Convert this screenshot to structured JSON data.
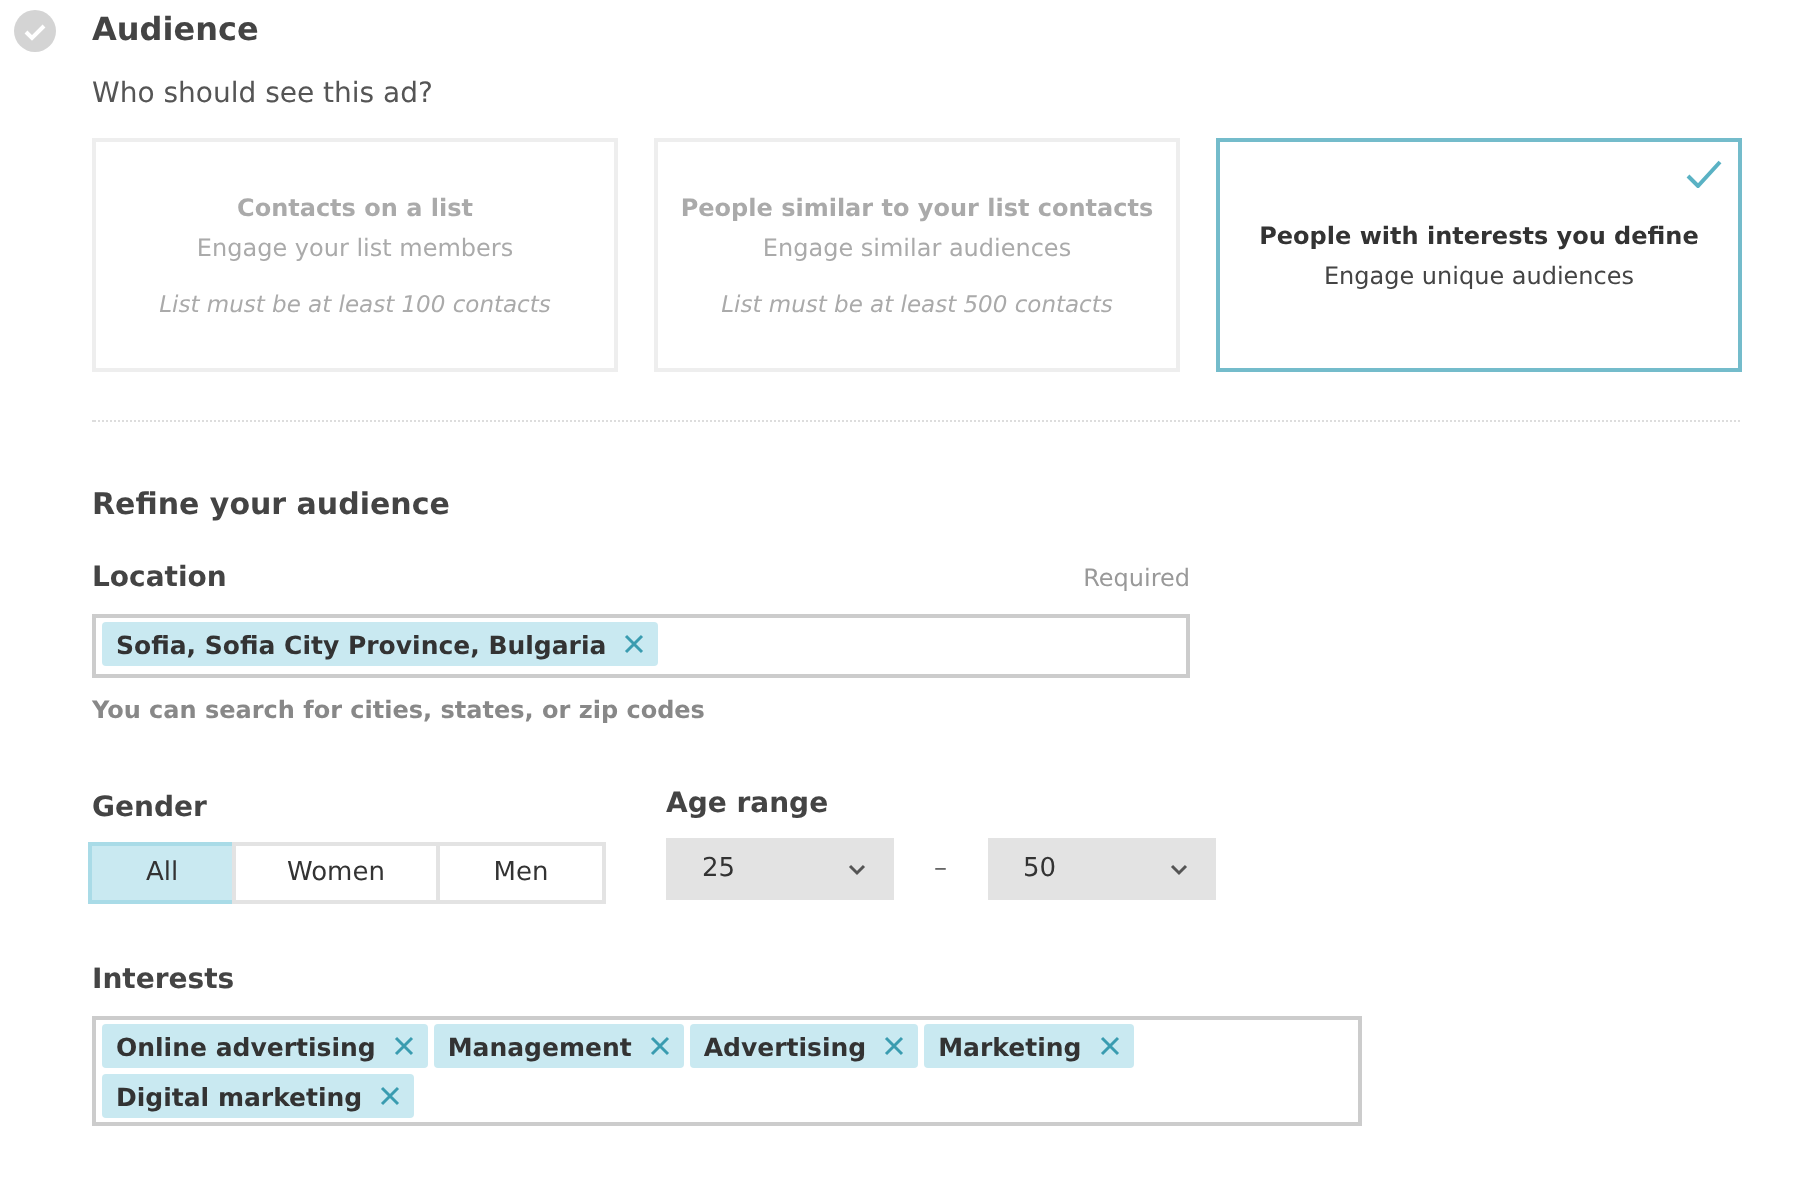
{
  "section": {
    "title": "Audience",
    "completed": true
  },
  "question": "Who should see this ad?",
  "audience_options": [
    {
      "title": "Contacts on a list",
      "subtitle": "Engage your list members",
      "note": "List must be at least 100 contacts",
      "selected": false
    },
    {
      "title": "People similar to your list contacts",
      "subtitle": "Engage similar audiences",
      "note": "List must be at least 500 contacts",
      "selected": false
    },
    {
      "title": "People with interests you define",
      "subtitle": "Engage unique audiences",
      "selected": true
    }
  ],
  "refine_title": "Refine your audience",
  "location": {
    "label": "Location",
    "required_label": "Required",
    "tags": [
      "Sofia, Sofia City Province, Bulgaria"
    ],
    "hint": "You can search for cities, states, or zip codes"
  },
  "gender": {
    "label": "Gender",
    "options": [
      {
        "label": "All",
        "selected": true
      },
      {
        "label": "Women",
        "selected": false
      },
      {
        "label": "Men",
        "selected": false
      }
    ]
  },
  "age_range": {
    "label": "Age range",
    "min": "25",
    "separator": "–",
    "max": "50"
  },
  "interests": {
    "label": "Interests",
    "tags": [
      "Online advertising",
      "Management",
      "Advertising",
      "Marketing",
      "Digital marketing"
    ]
  }
}
